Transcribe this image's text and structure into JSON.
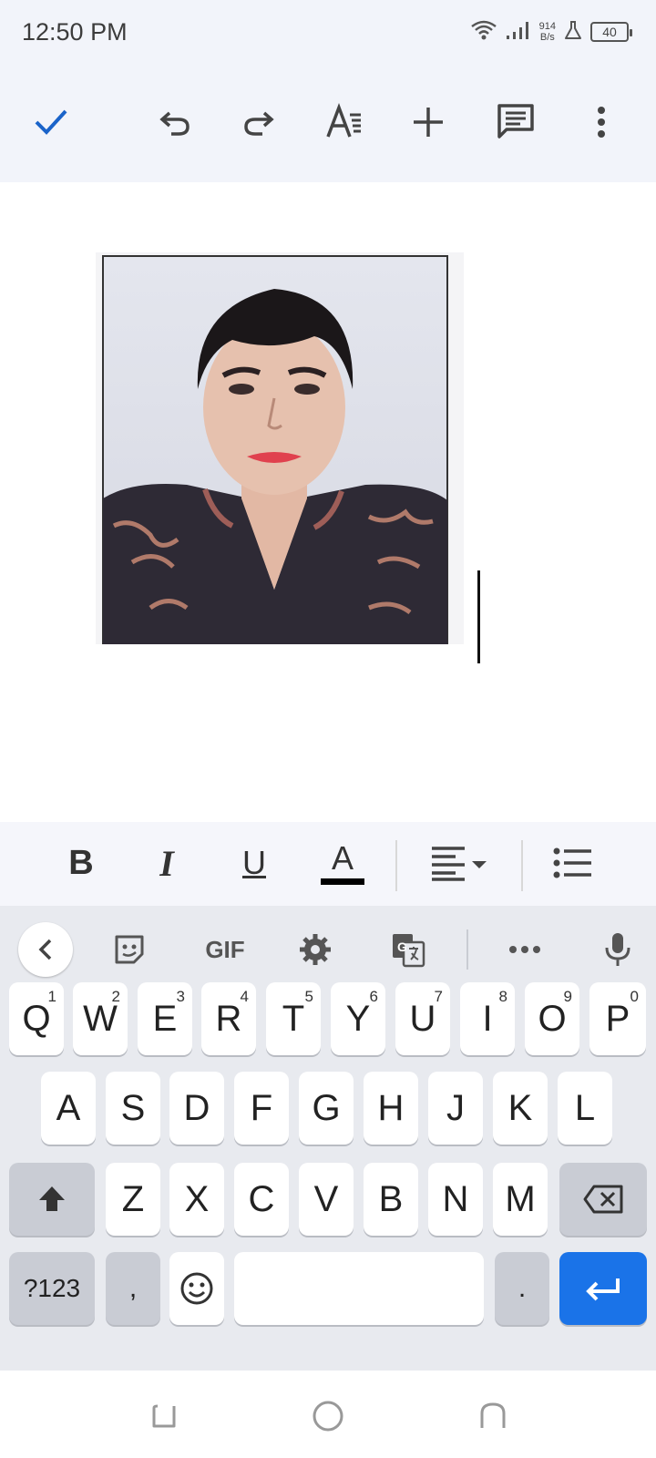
{
  "status_bar": {
    "time": "12:50 PM",
    "net_speed_value": "914",
    "net_speed_unit": "B/s",
    "battery": "40",
    "icons": [
      "wifi-icon",
      "signal-icon",
      "lab-icon",
      "battery-icon"
    ]
  },
  "toolbar": {
    "icons": [
      "check-icon",
      "undo-icon",
      "redo-icon",
      "text-format-icon",
      "insert-icon",
      "comment-icon",
      "more-vert-icon"
    ]
  },
  "document": {
    "image": "passport-photo-of-woman"
  },
  "format_bar": {
    "bold": "B",
    "italic": "I",
    "underline": "U",
    "text_color": "A",
    "text_color_value": "#000000"
  },
  "keyboard": {
    "toolbar": {
      "gif_label": "GIF",
      "icons": [
        "back-icon",
        "sticker-icon",
        "gif-icon",
        "settings-icon",
        "translate-icon",
        "more-horiz-icon",
        "mic-icon"
      ]
    },
    "row1": [
      {
        "key": "Q",
        "hint": "1"
      },
      {
        "key": "W",
        "hint": "2"
      },
      {
        "key": "E",
        "hint": "3"
      },
      {
        "key": "R",
        "hint": "4"
      },
      {
        "key": "T",
        "hint": "5"
      },
      {
        "key": "Y",
        "hint": "6"
      },
      {
        "key": "U",
        "hint": "7"
      },
      {
        "key": "I",
        "hint": "8"
      },
      {
        "key": "O",
        "hint": "9"
      },
      {
        "key": "P",
        "hint": "0"
      }
    ],
    "row2": [
      "A",
      "S",
      "D",
      "F",
      "G",
      "H",
      "J",
      "K",
      "L"
    ],
    "row3": [
      "Z",
      "X",
      "C",
      "V",
      "B",
      "N",
      "M"
    ],
    "row4": {
      "symbols": "?123",
      "comma": ",",
      "period": "."
    },
    "accent_color": "#1a73e8"
  },
  "nav_bar": {
    "icons": [
      "recents-icon",
      "home-icon",
      "back-nav-icon"
    ]
  }
}
